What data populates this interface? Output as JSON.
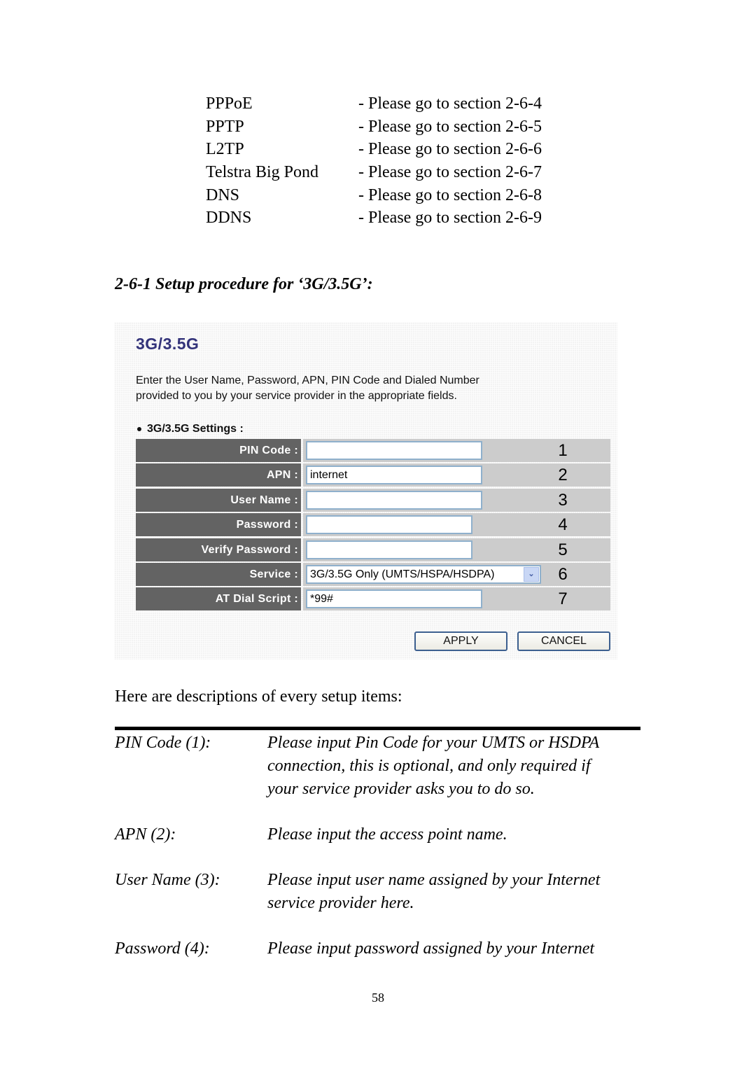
{
  "sections": [
    {
      "name": "PPPoE",
      "ref": "- Please go to section 2-6-4"
    },
    {
      "name": "PPTP",
      "ref": "- Please go to section 2-6-5"
    },
    {
      "name": "L2TP",
      "ref": "- Please go to section 2-6-6"
    },
    {
      "name": "Telstra Big Pond",
      "ref": "- Please go to section 2-6-7"
    },
    {
      "name": "DNS",
      "ref": "- Please go to section 2-6-8"
    },
    {
      "name": "DDNS",
      "ref": "- Please go to section 2-6-9"
    }
  ],
  "subheading": "2-6-1 Setup procedure for ‘3G/3.5G’:",
  "panel": {
    "title": "3G/3.5G",
    "desc_line1": "Enter the User Name, Password, APN, PIN Code and Dialed Number",
    "desc_line2": "provided to you by your service provider in the appropriate fields.",
    "settings_heading": "3G/3.5G Settings :",
    "fields": [
      {
        "label": "PIN Code :",
        "value": "",
        "number": "1"
      },
      {
        "label": "APN :",
        "value": "internet",
        "number": "2"
      },
      {
        "label": "User Name :",
        "value": "",
        "number": "3"
      },
      {
        "label": "Password :",
        "value": "",
        "number": "4"
      },
      {
        "label": "Verify Password :",
        "value": "",
        "number": "5"
      },
      {
        "label": "Service :",
        "value": "3G/3.5G Only (UMTS/HSPA/HSDPA)",
        "number": "6"
      },
      {
        "label": "AT Dial Script :",
        "value": "*99#",
        "number": "7"
      }
    ],
    "apply_label": "APPLY",
    "cancel_label": "CANCEL",
    "colors": {
      "title": "#33337a",
      "label_bg": "#636363",
      "cell_bg": "#cccccc",
      "input_border": "#8fb0cc"
    }
  },
  "intro": "Here are descriptions of every setup items:",
  "descriptions": [
    {
      "term": "PIN Code (1):",
      "lines": [
        "Please input Pin Code for your UMTS or HSDPA",
        "connection, this is optional, and only required if",
        "your service provider asks you to do so."
      ]
    },
    {
      "term": "APN (2):",
      "lines": [
        "Please input the access point name."
      ]
    },
    {
      "term": "User Name (3):",
      "lines": [
        "Please input user name assigned by your Internet",
        "service provider here."
      ]
    },
    {
      "term": "Password (4):",
      "lines": [
        "Please input password assigned by your Internet"
      ]
    }
  ],
  "page_number": "58"
}
